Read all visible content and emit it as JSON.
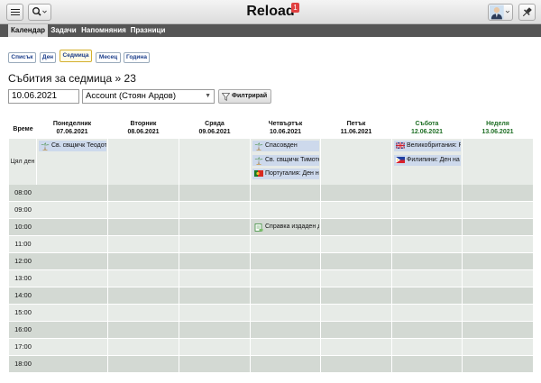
{
  "app": {
    "title": "Reload",
    "notification_count": "1"
  },
  "icons": {
    "menu": "hamburger-icon",
    "search": "search-icon",
    "pin": "pin-icon",
    "palm": "palm-tree-icon",
    "flag_portugal": "flag-portugal-icon",
    "flag_uk": "flag-uk-icon",
    "flag_philippines": "flag-philippines-icon",
    "document": "document-icon",
    "filter": "funnel-icon"
  },
  "tabs": [
    "Календар",
    "Задачи",
    "Напомняния",
    "Празници"
  ],
  "active_tab": "Календар",
  "view_buttons": [
    "Списък",
    "Ден",
    "Седмица",
    "Месец",
    "Година"
  ],
  "active_view": "Седмица",
  "heading": "Събития за седмица » 23",
  "filters": {
    "date": "10.06.2021",
    "account": "Account (Стоян Ардов)",
    "filter_button": "Филтрирай"
  },
  "calendar": {
    "time_header": "Време",
    "all_day_label": "Цял ден",
    "days": [
      {
        "name": "Понеделник",
        "date": "07.06.2021",
        "weekend": false
      },
      {
        "name": "Вторник",
        "date": "08.06.2021",
        "weekend": false
      },
      {
        "name": "Сряда",
        "date": "09.06.2021",
        "weekend": false
      },
      {
        "name": "Четвъртък",
        "date": "10.06.2021",
        "weekend": false
      },
      {
        "name": "Петък",
        "date": "11.06.2021",
        "weekend": false
      },
      {
        "name": "Събота",
        "date": "12.06.2021",
        "weekend": true
      },
      {
        "name": "Неделя",
        "date": "13.06.2021",
        "weekend": true
      }
    ],
    "times": [
      "08:00",
      "09:00",
      "10:00",
      "11:00",
      "12:00",
      "13:00",
      "14:00",
      "15:00",
      "16:00",
      "17:00",
      "18:00"
    ],
    "all_day_events": [
      {
        "day": 0,
        "row": 0,
        "title": "Св. свщмчк Теодот",
        "icon": "palm-tree-icon"
      },
      {
        "day": 3,
        "row": 0,
        "title": "Спасовден",
        "icon": "palm-tree-icon"
      },
      {
        "day": 3,
        "row": 1,
        "title": "Св. свщмчк Тимотей",
        "icon": "palm-tree-icon"
      },
      {
        "day": 3,
        "row": 2,
        "title": "Португалия: Ден на Португалия",
        "icon": "flag-portugal-icon"
      },
      {
        "day": 5,
        "row": 0,
        "title": "Великобритания: Рожден ден на кралицата",
        "icon": "flag-uk-icon"
      },
      {
        "day": 5,
        "row": 1,
        "title": "Филипини: Ден на независимостта",
        "icon": "flag-philippines-icon"
      }
    ],
    "timed_events": [
      {
        "day": 3,
        "time_index": 2,
        "title": "Справка издаден документ",
        "icon": "document-icon"
      }
    ]
  }
}
